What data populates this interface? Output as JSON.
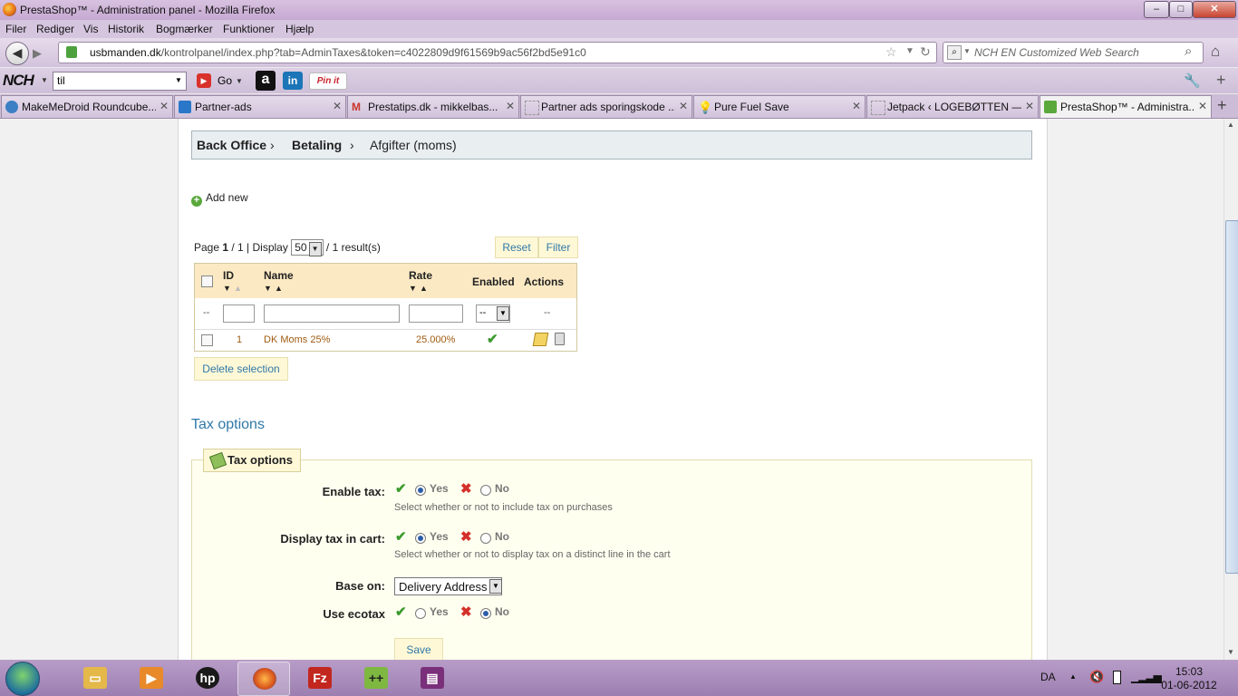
{
  "window": {
    "title": "PrestaShop™ - Administration panel - Mozilla Firefox",
    "min": "–",
    "max": "□",
    "close": "✕"
  },
  "menubar": [
    "Filer",
    "Rediger",
    "Vis",
    "Historik",
    "Bogmærker",
    "Funktioner",
    "Hjælp"
  ],
  "navbar": {
    "url_domain": "usbmanden.dk",
    "url_path": "/kontrolpanel/index.php?tab=AdminTaxes&token=c4022809d9f61569b9ac56f2bd5e91c0",
    "search_placeholder": "NCH EN Customized Web Search"
  },
  "toolbar": {
    "nch_logo": "NCH",
    "search_value": "til",
    "go_label": "Go",
    "pinit_label": "Pin it"
  },
  "tabs": [
    {
      "label": "MakeMeDroid Roundcube...",
      "icon_color": "#3c7fc4"
    },
    {
      "label": "Partner-ads",
      "icon_color": "#2a77c9"
    },
    {
      "label": "Prestatips.dk - mikkelbas...",
      "icon_color": "#c9342a"
    },
    {
      "label": "Partner ads sporingskode ...",
      "icon_color": "#999999"
    },
    {
      "label": "Pure Fuel Save",
      "icon_color": "#e8c33a"
    },
    {
      "label": "Jetpack ‹ LOGEBØTTEN —...",
      "icon_color": "#999999"
    },
    {
      "label": "PrestaShop™ - Administra...",
      "icon_color": "#5aa83c"
    }
  ],
  "breadcrumb": [
    "Back Office",
    "Betaling",
    "Afgifter (moms)"
  ],
  "add_new": "Add new",
  "pager": {
    "page_prefix": "Page ",
    "page": "1",
    "page_suffix": " / 1 | Display",
    "display": "50",
    "results": "/ 1 result(s)"
  },
  "buttons": {
    "reset": "Reset",
    "filter": "Filter",
    "delete_selection": "Delete selection",
    "save": "Save"
  },
  "table": {
    "headers": {
      "id": "ID",
      "name": "Name",
      "rate": "Rate",
      "enabled": "Enabled",
      "actions": "Actions"
    },
    "filter_dash": "--",
    "enabled_filter": "--",
    "actions_filter": "--",
    "rows": [
      {
        "id": "1",
        "name": "DK Moms 25%",
        "rate": "25.000%"
      }
    ]
  },
  "tax_options": {
    "section_title": "Tax options",
    "legend": "Tax options",
    "enable_tax": {
      "label": "Enable tax:",
      "yes": "Yes",
      "no": "No",
      "hint": "Select whether or not to include tax on purchases"
    },
    "display_tax": {
      "label": "Display tax in cart:",
      "yes": "Yes",
      "no": "No",
      "hint": "Select whether or not to display tax on a distinct line in the cart"
    },
    "base_on": {
      "label": "Base on:",
      "value": "Delivery Address"
    },
    "use_ecotax": {
      "label": "Use ecotax",
      "yes": "Yes",
      "no": "No"
    }
  },
  "tray": {
    "language": "DA",
    "time": "15:03",
    "date": "01-06-2012"
  }
}
